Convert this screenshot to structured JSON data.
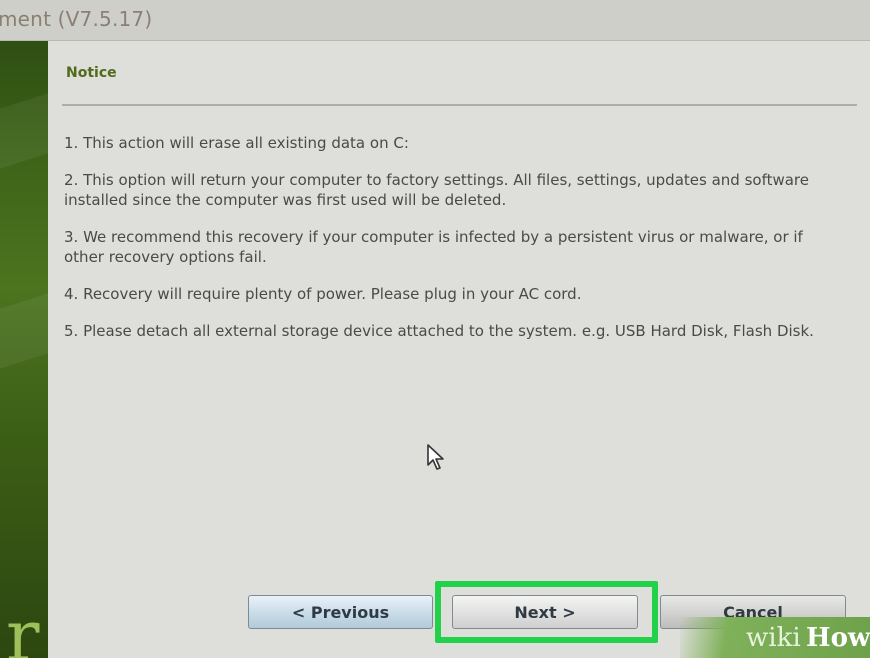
{
  "window": {
    "title": "ment (V7.5.17)"
  },
  "dialog": {
    "heading": "Notice",
    "items": [
      "1. This action will erase all existing data on C:",
      "2. This option will return your computer to factory settings. All files, settings, updates and software installed since the computer was first used will be deleted.",
      "3. We recommend this recovery if your computer is infected by a persistent virus or malware, or if other recovery options fail.",
      "4. Recovery will require plenty of power. Please plug in your AC cord.",
      "5. Please detach all external storage device attached to the system. e.g. USB Hard Disk, Flash Disk."
    ]
  },
  "buttons": {
    "previous": "< Previous",
    "next": "Next >",
    "cancel": "Cancel"
  },
  "highlight": {
    "target": "next-button",
    "color": "#21d14a"
  },
  "watermark": {
    "part1": "wiki",
    "part2": "How"
  },
  "colors": {
    "heading": "#4f6b1b",
    "sidebar": "#3d6318"
  },
  "icons": {
    "cursor": "mouse-pointer-icon",
    "sidebar_glyph": "brand-glyph-icon"
  }
}
